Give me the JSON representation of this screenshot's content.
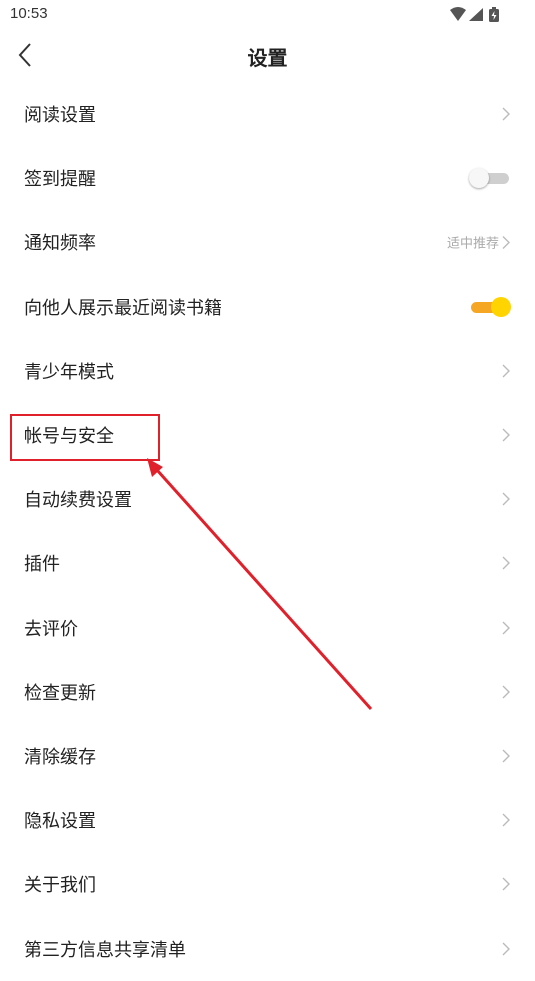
{
  "status_bar": {
    "time": "10:53"
  },
  "header": {
    "title": "设置"
  },
  "settings": {
    "items": [
      {
        "label": "阅读设置",
        "type": "link",
        "value": ""
      },
      {
        "label": "签到提醒",
        "type": "toggle",
        "on": false
      },
      {
        "label": "通知频率",
        "type": "link",
        "value": "适中推荐"
      },
      {
        "label": "向他人展示最近阅读书籍",
        "type": "toggle",
        "on": true
      },
      {
        "label": "青少年模式",
        "type": "link",
        "value": ""
      },
      {
        "label": "帐号与安全",
        "type": "link",
        "value": ""
      },
      {
        "label": "自动续费设置",
        "type": "link",
        "value": ""
      },
      {
        "label": "插件",
        "type": "link",
        "value": ""
      },
      {
        "label": "去评价",
        "type": "link",
        "value": ""
      },
      {
        "label": "检查更新",
        "type": "link",
        "value": ""
      },
      {
        "label": "清除缓存",
        "type": "link",
        "value": ""
      },
      {
        "label": "隐私设置",
        "type": "link",
        "value": ""
      },
      {
        "label": "关于我们",
        "type": "link",
        "value": ""
      },
      {
        "label": "第三方信息共享清单",
        "type": "link",
        "value": ""
      }
    ]
  },
  "annotation": {
    "highlighted_item": "帐号与安全",
    "color": "#e0202a"
  },
  "colors": {
    "toggle_on_track": "#f5a623",
    "toggle_on_knob": "#ffd400",
    "toggle_off_track": "#cfcfcf"
  },
  "icons": {
    "back": "chevron-left-icon",
    "row_arrow": "chevron-right-icon"
  }
}
